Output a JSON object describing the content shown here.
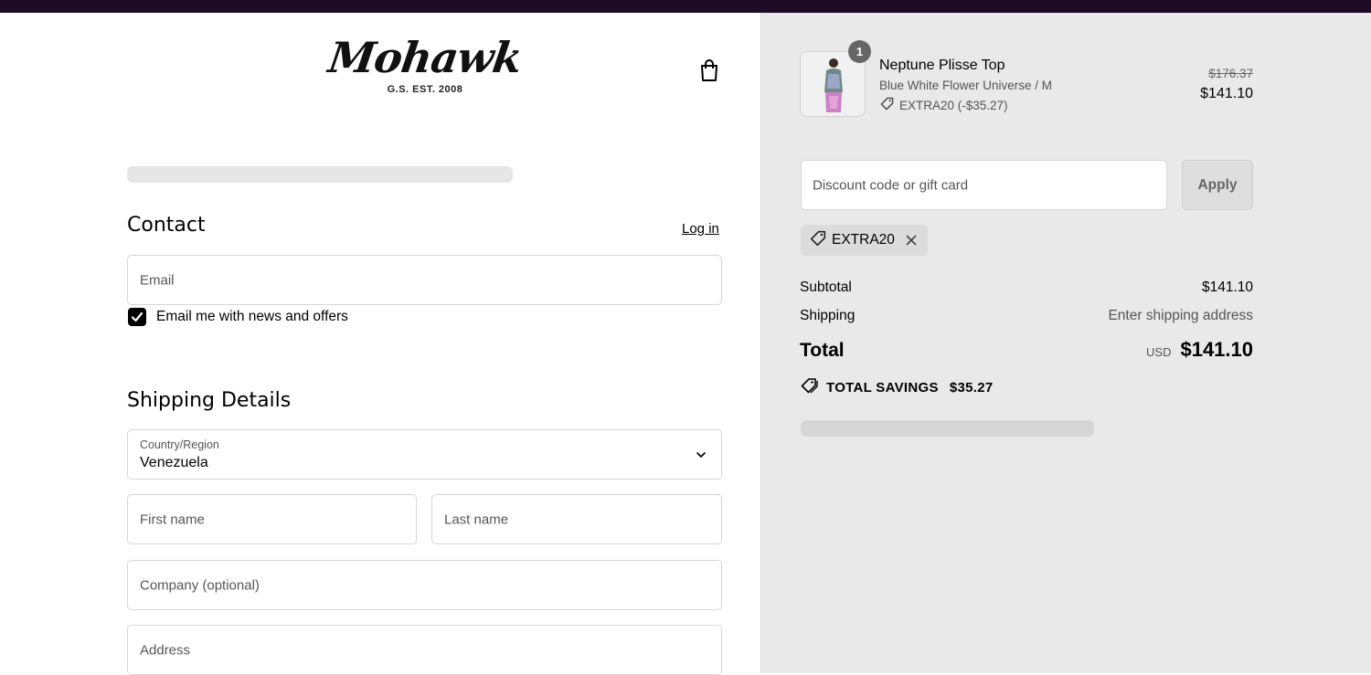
{
  "brand": {
    "logo_text": "Mohawk",
    "logo_sub": "G.S. EST. 2008",
    "cart_icon": "shopping-bag-icon"
  },
  "contact": {
    "heading": "Contact",
    "login_link": "Log in",
    "email_placeholder": "Email",
    "newsletter_label": "Email me with news and offers",
    "newsletter_checked": true
  },
  "shipping": {
    "heading": "Shipping Details",
    "country_label": "Country/Region",
    "country_value": "Venezuela",
    "first_name_placeholder": "First name",
    "last_name_placeholder": "Last name",
    "company_placeholder": "Company (optional)",
    "address_placeholder": "Address"
  },
  "order": {
    "item": {
      "name": "Neptune Plisse Top",
      "variant": "Blue White Flower Universe / M",
      "discount": "EXTRA20 (-$35.27)",
      "quantity": "1",
      "price_original": "$176.37",
      "price_final": "$141.10"
    },
    "discount_placeholder": "Discount code or gift card",
    "apply_label": "Apply",
    "applied_code": "EXTRA20",
    "subtotal_label": "Subtotal",
    "subtotal_value": "$141.10",
    "shipping_label": "Shipping",
    "shipping_value": "Enter shipping address",
    "total_label": "Total",
    "currency": "USD",
    "total_value": "$141.10",
    "savings_label": "TOTAL SAVINGS",
    "savings_value": "$35.27"
  },
  "colors": {
    "topbar": "#1d0c23",
    "summary_bg": "#e9e9e9",
    "checkbox": "#000000"
  }
}
